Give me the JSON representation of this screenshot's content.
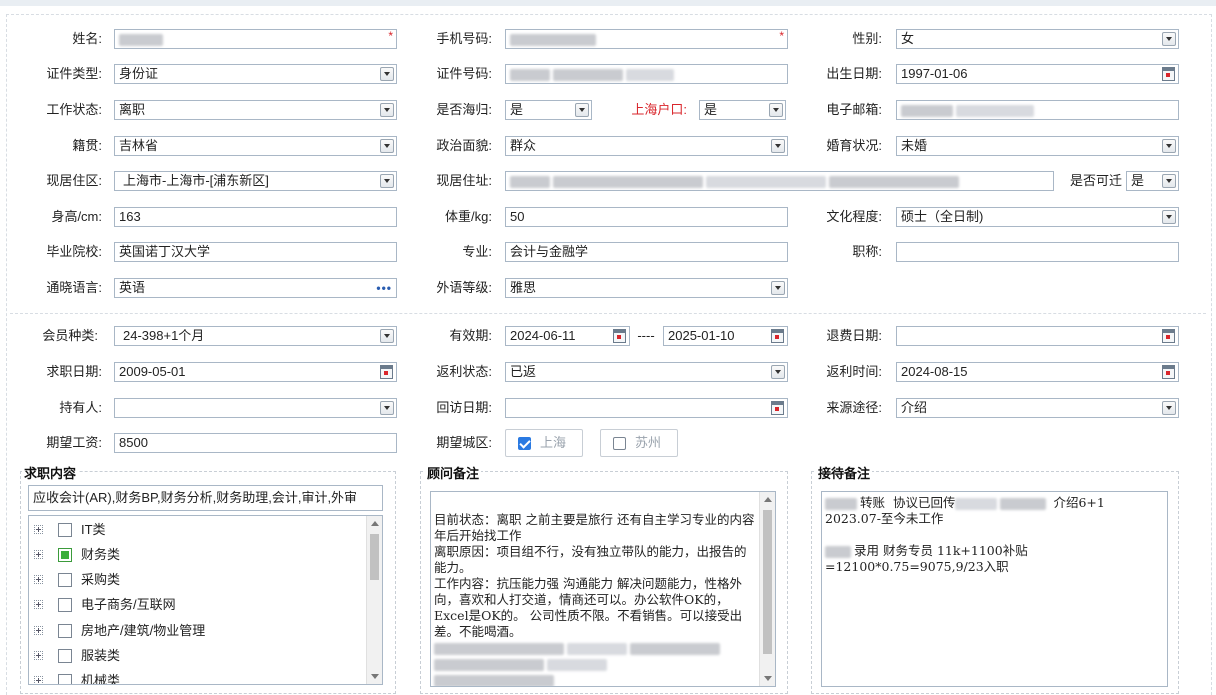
{
  "basic": {
    "name": {
      "label": "姓名:",
      "required_mark": "*"
    },
    "phone": {
      "label": "手机号码:",
      "required_mark": "*"
    },
    "gender": {
      "label": "性别:",
      "value": "女"
    },
    "id_type": {
      "label": "证件类型:",
      "value": "身份证"
    },
    "id_number": {
      "label": "证件号码:"
    },
    "birth_date": {
      "label": "出生日期:",
      "value": "1997-01-06"
    },
    "work_status": {
      "label": "工作状态:",
      "value": "离职"
    },
    "returnee": {
      "label": "是否海归:",
      "value": "是"
    },
    "sh_hukou": {
      "label": "上海户口:",
      "value": "是"
    },
    "email": {
      "label": "电子邮箱:"
    },
    "native_place": {
      "label": "籍贯:",
      "value": "吉林省"
    },
    "political_status": {
      "label": "政治面貌:",
      "value": "群众"
    },
    "marital_status": {
      "label": "婚育状况:",
      "value": "未婚"
    },
    "residence_area": {
      "label": "现居住区:",
      "value": "上海市-上海市-[浦东新区]"
    },
    "address": {
      "label": "现居住址:"
    },
    "relocatable": {
      "label": "是否可迁",
      "value": "是"
    },
    "height": {
      "label": "身高/cm:",
      "value": "163"
    },
    "weight": {
      "label": "体重/kg:",
      "value": "50"
    },
    "education": {
      "label": "文化程度:",
      "value": "硕士（全日制)"
    },
    "school": {
      "label": "毕业院校:",
      "value": "英国诺丁汉大学"
    },
    "major": {
      "label": "专业:",
      "value": "会计与金融学"
    },
    "title": {
      "label": "职称:",
      "value": ""
    },
    "language": {
      "label": "通晓语言:",
      "value": "英语"
    },
    "language_level": {
      "label": "外语等级:",
      "value": "雅思"
    }
  },
  "membership": {
    "member_type": {
      "label": "会员种类:",
      "value": "24-398+1个月"
    },
    "valid_period": {
      "label": "有效期:",
      "start": "2024-06-11",
      "separator": "----",
      "end": "2025-01-10"
    },
    "refund_date": {
      "label": "退费日期:",
      "value": ""
    },
    "job_search_date": {
      "label": "求职日期:",
      "value": "2009-05-01"
    },
    "rebate_status": {
      "label": "返利状态:",
      "value": "已返"
    },
    "rebate_time": {
      "label": "返利时间:",
      "value": "2024-08-15"
    },
    "holder": {
      "label": "持有人:",
      "value": ""
    },
    "revisit_date": {
      "label": "回访日期:",
      "value": ""
    },
    "source": {
      "label": "来源途径:",
      "value": "介绍"
    },
    "expected_salary": {
      "label": "期望工资:",
      "value": "8500"
    },
    "expected_city": {
      "label": "期望城区:",
      "options": [
        {
          "label": "上海",
          "checked": true
        },
        {
          "label": "苏州",
          "checked": false
        }
      ]
    }
  },
  "job_intent": {
    "title": "求职内容",
    "selected_summary": "应收会计(AR),财务BP,财务分析,财务助理,会计,审计,外审",
    "categories": [
      {
        "label": "IT类",
        "state": "unchecked"
      },
      {
        "label": "财务类",
        "state": "partial"
      },
      {
        "label": "采购类",
        "state": "unchecked"
      },
      {
        "label": "电子商务/互联网",
        "state": "unchecked"
      },
      {
        "label": "房地产/建筑/物业管理",
        "state": "unchecked"
      },
      {
        "label": "服装类",
        "state": "unchecked"
      },
      {
        "label": "机械类",
        "state": "unchecked"
      }
    ]
  },
  "advisor_notes": {
    "title": "顾问备注",
    "lines": [
      "目前状态：离职 之前主要是旅行 还有自主学习专业的内容 年后开始找工作",
      "离职原因：项目组不行，没有独立带队的能力，出报告的能力。",
      "工作内容：抗压能力强 沟通能力 解决问题能力，性格外向，喜欢和人打交道，情商还可以。办公软件OK的，Excel是OK的。 公司性质不限。不看销售。可以接受出差。不能喝酒。"
    ]
  },
  "reception_notes": {
    "title": "接待备注",
    "line1_a": "转账",
    "line1_b": "协议已回传",
    "line1_c": "介绍6+1",
    "line2": "2023.07-至今未工作",
    "line3": "录用 财务专员 11k+1100补贴",
    "line4": "=12100*0.75=9075,9/23入职"
  },
  "colors": {
    "border": "#a9b7c6",
    "required": "#d9252b",
    "check_accent": "#2a7ae2",
    "tree_partial": "#3aae3a"
  }
}
